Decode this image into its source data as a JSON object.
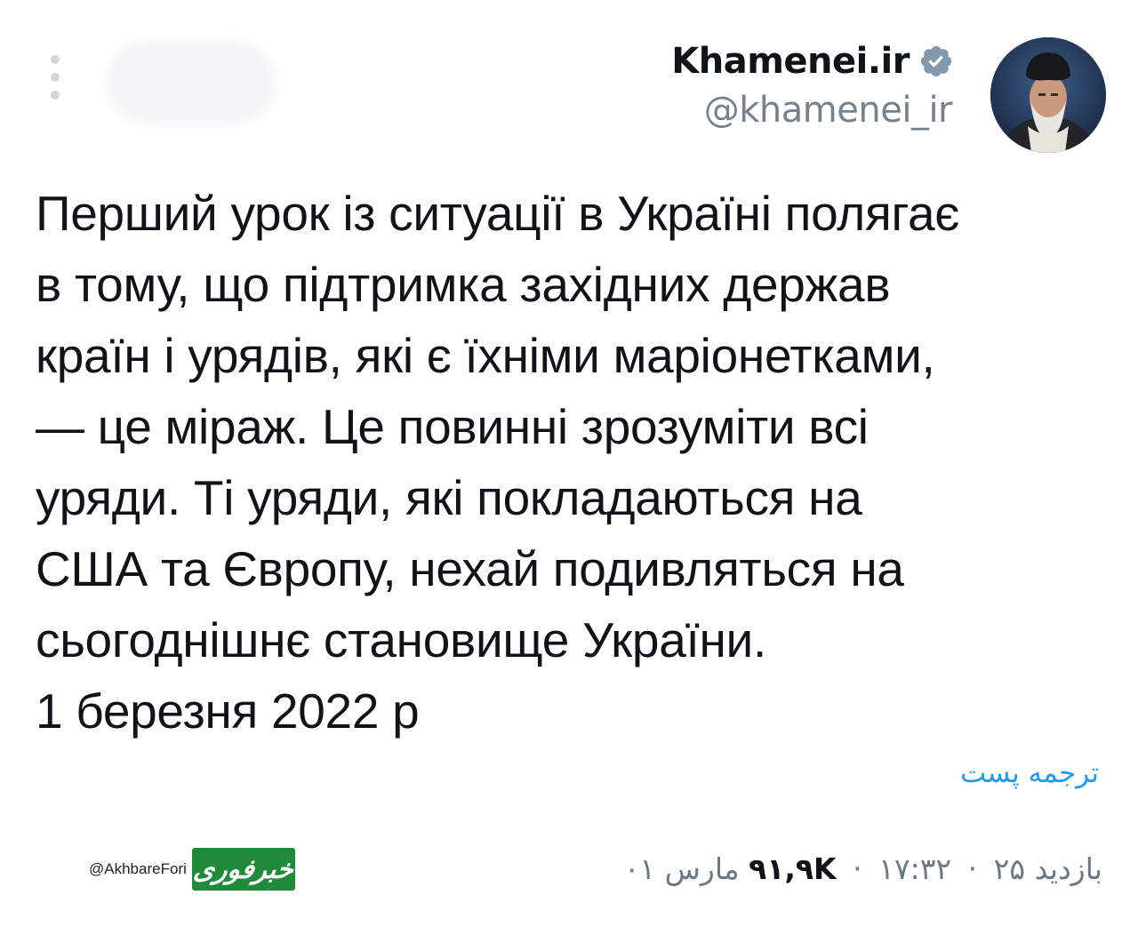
{
  "author": {
    "display_name": "Khamenei.ir",
    "handle": "@khamenei_ir",
    "verified": true,
    "verified_color": "#829aab"
  },
  "tweet": {
    "lines": [
      "Перший урок із ситуації в Україні полягає",
      "в тому, що підтримка західних держав",
      "країн і урядів, які є їхніми маріонетками,",
      "— це міраж. Це повинні зрозуміти всі",
      "уряди. Ті уряди, які покладаються на",
      "США та Європу, нехай подивляться на",
      "сьогоднішнє становище України.",
      "1 березня 2022 р"
    ],
    "translate_label": "ترجمه پست"
  },
  "meta": {
    "time": "۱۷:۳۲",
    "date": "۲۵ مارس ۰۱",
    "views_count": "۹۱,۹K",
    "views_label": "بازدید",
    "separator": "·"
  },
  "watermark": {
    "handle": "@AkhbareFori",
    "logo_text": "خبرفوری"
  },
  "colors": {
    "link": "#1d9bf0",
    "secondary_text": "#75818c",
    "watermark_green": "#1f8a39"
  }
}
